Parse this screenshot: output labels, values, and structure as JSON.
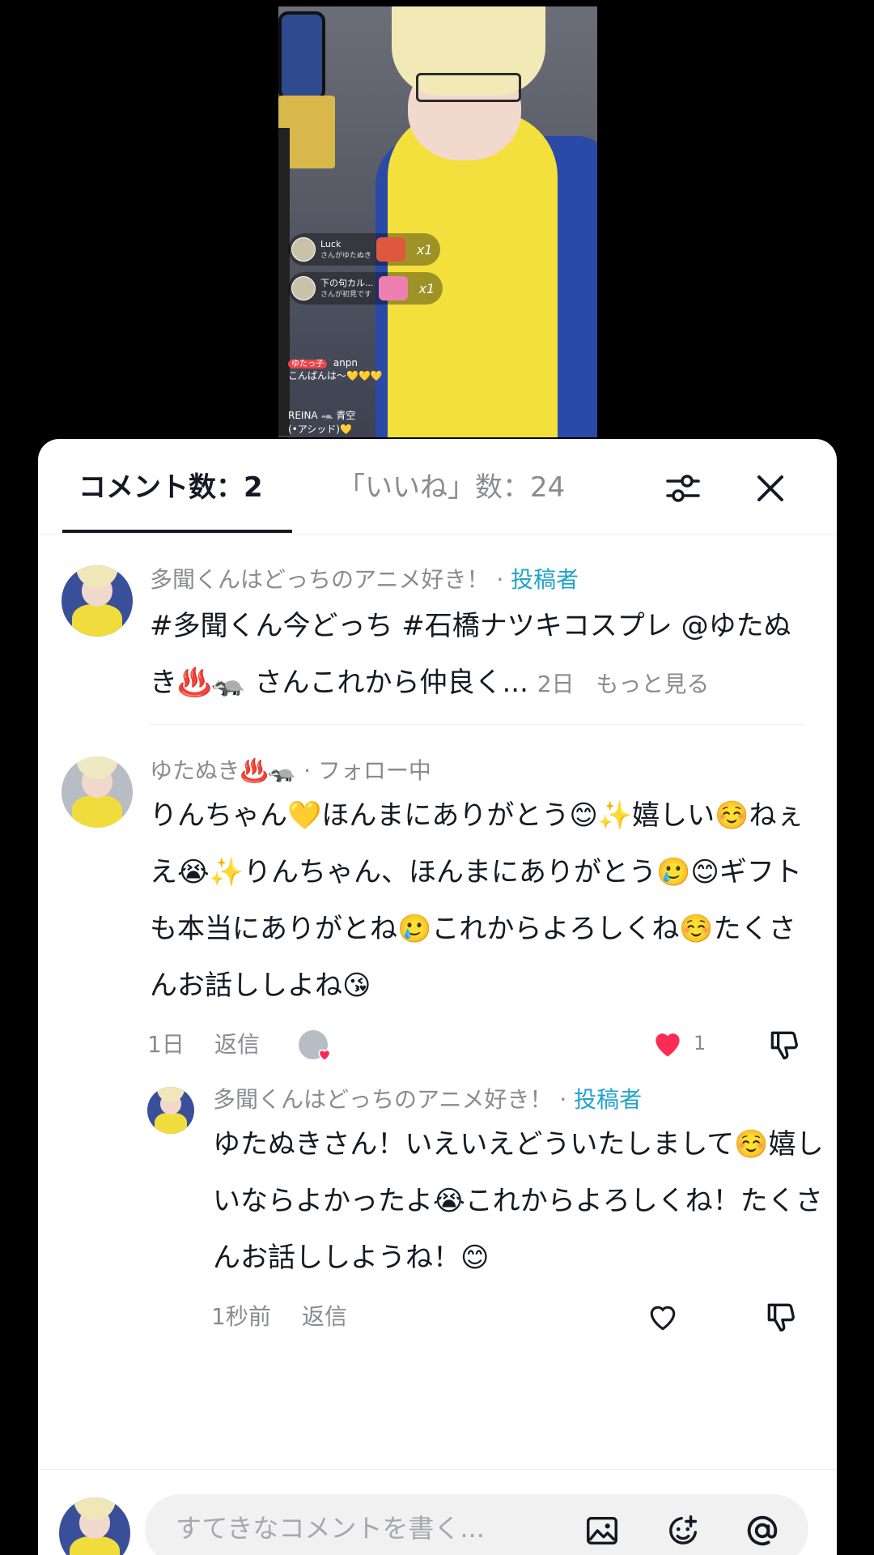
{
  "video": {
    "gifts": [
      {
        "name": "Luck",
        "sub": "さんがゆたぬき",
        "count": "x1"
      },
      {
        "name": "下の句カル...",
        "sub": "さんが初見です",
        "count": "x1"
      }
    ],
    "chat": [
      {
        "badge": "ゆたっ子",
        "user": "anpn",
        "text": "こんばんは〜💛💛💛"
      },
      {
        "badge": "",
        "user": "REINA 🦡 青空",
        "text": "(•アシッド)💛"
      }
    ]
  },
  "tabs": {
    "comments_label": "コメント数：2",
    "likes_label": "「いいね」数：24"
  },
  "icons": {
    "filter": "filter-sliders-icon",
    "close": "close-icon",
    "heart_filled": "heart-filled-icon",
    "heart_outline": "heart-outline-icon",
    "dislike": "thumbs-down-icon",
    "image": "image-icon",
    "emoji": "emoji-icon",
    "mention": "at-mention-icon"
  },
  "colors": {
    "author_tag": "#20a4c9",
    "like_red": "#fe2c55",
    "text_primary": "#161823",
    "text_secondary": "#8a8b91"
  },
  "comments": [
    {
      "username": "多聞くんはどっちのアニメ好き！",
      "tag": "投稿者",
      "separator": " · ",
      "text": "#多聞くん今どっち #石橋ナツキコスプレ @ゆたぬき♨️🦡 さんこれから仲良く...",
      "time": "2日",
      "more": "もっと見る"
    },
    {
      "username": "ゆたぬき♨️🦡",
      "tag": "フォロー中",
      "separator": " · ",
      "text": "りんちゃん💛ほんまにありがとう😊✨嬉しい☺️ねぇえ😭✨りんちゃん、ほんまにありがとう🥲😊ギフトも本当にありがとね🥲これからよろしくね☺️たくさんお話ししよね😘",
      "time": "1日",
      "reply": "返信",
      "likes": "1"
    },
    {
      "username": "多聞くんはどっちのアニメ好き！",
      "tag": "投稿者",
      "separator": " · ",
      "text": "ゆたぬきさん！いえいえどういたしまして☺️嬉しいならよかったよ😭これからよろしくね！たくさんお話ししようね！😊",
      "time": "1秒前",
      "reply": "返信"
    }
  ],
  "input": {
    "placeholder": "すてきなコメントを書く..."
  }
}
